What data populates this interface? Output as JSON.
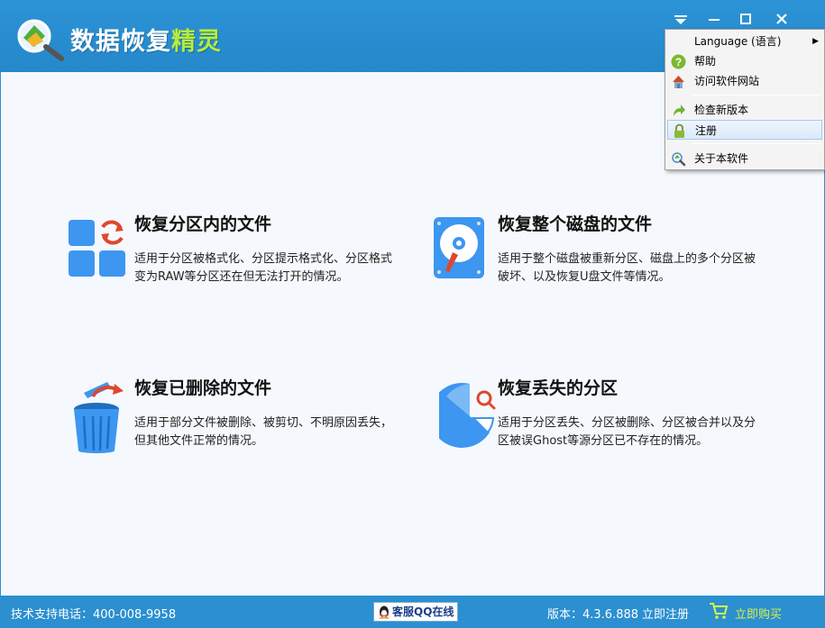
{
  "app": {
    "title_main": "数据恢复",
    "title_accent": "精灵"
  },
  "cards": [
    {
      "title": "恢复分区内的文件",
      "desc": "适用于分区被格式化、分区提示格式化、分区格式变为RAW等分区还在但无法打开的情况。",
      "icon": "partition-recover-icon"
    },
    {
      "title": "恢复整个磁盘的文件",
      "desc": "适用于整个磁盘被重新分区、磁盘上的多个分区被破坏、以及恢复U盘文件等情况。",
      "icon": "hard-disk-icon"
    },
    {
      "title": "恢复已删除的文件",
      "desc": "适用于部分文件被删除、被剪切、不明原因丢失，但其他文件正常的情况。",
      "icon": "recycle-bin-icon"
    },
    {
      "title": "恢复丢失的分区",
      "desc": "适用于分区丢失、分区被删除、分区被合并以及分区被误Ghost等源分区已不存在的情况。",
      "icon": "pie-search-icon"
    }
  ],
  "status": {
    "support": "技术支持电话：400-008-9958",
    "qq": "客服QQ在线",
    "version": "版本：4.3.6.888",
    "register": "立即注册",
    "buy": "立即购买"
  },
  "menu": {
    "items": [
      {
        "label": "Language (语言)",
        "icon": "",
        "submenu": true
      },
      {
        "label": "帮助",
        "icon": "help-icon"
      },
      {
        "label": "访问软件网站",
        "icon": "home-icon"
      },
      {
        "label": "检查新版本",
        "icon": "update-arrow-icon"
      },
      {
        "label": "注册",
        "icon": "lock-icon"
      },
      {
        "label": "关于本软件",
        "icon": "about-icon"
      }
    ],
    "submenu_arrow": "▶"
  },
  "colors": {
    "titlebar": "#2b8fd0",
    "accent_green": "#b6ec3c",
    "tile_blue": "#3d96f0",
    "red": "#e0462e"
  }
}
